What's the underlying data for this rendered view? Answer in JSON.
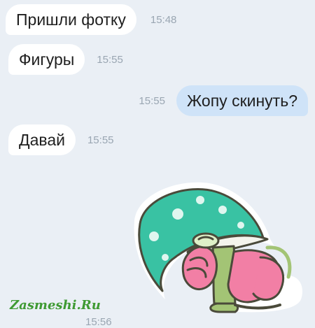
{
  "messages": [
    {
      "text": "Пришли фотку",
      "time": "15:48",
      "direction": "incoming"
    },
    {
      "text": "Фигуры",
      "time": "15:55",
      "direction": "incoming"
    },
    {
      "text": "Жопу скинуть?",
      "time": "15:55",
      "direction": "outgoing"
    },
    {
      "text": "Давай",
      "time": "15:55",
      "direction": "incoming"
    },
    {
      "sticker": "mushroom-frog-sticker",
      "time": "15:56",
      "direction": "incoming"
    }
  ],
  "watermark": "Zasmeshi.Ru",
  "colors": {
    "background": "#eaeff5",
    "incoming_bubble": "#ffffff",
    "outgoing_bubble": "#cfe3f8",
    "time_text": "#9aa6b2",
    "watermark": "#3f9a33"
  }
}
